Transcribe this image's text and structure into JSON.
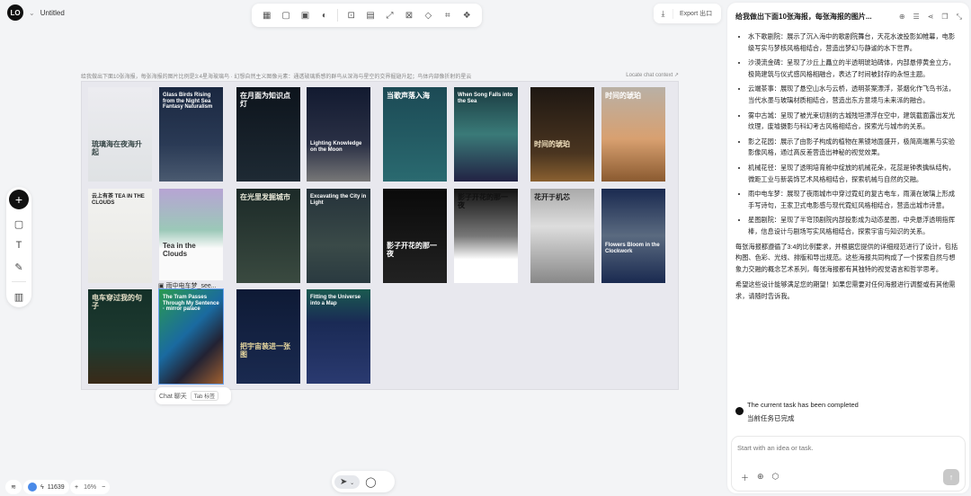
{
  "app": {
    "logo": "LO",
    "title": "Untitled"
  },
  "toolbar": {
    "tools": [
      {
        "icon": "mosaic-icon",
        "glyph": "▦"
      },
      {
        "icon": "square-icon",
        "glyph": "▢"
      },
      {
        "icon": "frame-text-icon",
        "glyph": "▣"
      },
      {
        "icon": "erase-bg-icon",
        "glyph": "◐"
      },
      {
        "icon": "ai-edit-icon",
        "glyph": "⊡"
      },
      {
        "icon": "hd-icon",
        "glyph": "▤"
      },
      {
        "icon": "expand-icon",
        "glyph": "⤢"
      },
      {
        "icon": "image-icon",
        "glyph": "⊠"
      },
      {
        "icon": "eraser-icon",
        "glyph": "◇"
      },
      {
        "icon": "crop-icon",
        "glyph": "⌗"
      },
      {
        "icon": "layers-3d-icon",
        "glyph": "❖"
      }
    ]
  },
  "export": {
    "label": "Export 出口"
  },
  "canvas": {
    "context_prompt": "给我做出下面10张海报，每张海报的图片比例是3:4星海玻璃鸟 · 幻想自然主义图像元素：通透玻璃质感的群鸟从深海与星空的交界掘翅升起；鸟体内部像折射的星云",
    "locate_label": "Locate chat context ↗",
    "selected_caption": "雨中电车梦_see...",
    "posters": [
      {
        "title": "琉璃海在夜海升起",
        "bg": "linear-gradient(#ececf0,#dfe2e4)",
        "color": "#3a4a4a"
      },
      {
        "title": "Glass Birds Rising from the Night Sea Fantasy Naturalism",
        "bg": "linear-gradient(#1a2740,#2a3a55 60%,#4a5a70)",
        "color": "#fff"
      },
      {
        "title": "在月面为知识点灯",
        "bg": "linear-gradient(#0d141c,#1e2a34)",
        "color": "#fff"
      },
      {
        "title": "Lighting Knowledge on the Moon",
        "bg": "linear-gradient(#121a30,#2a3045 60%,#777)",
        "color": "#fff"
      },
      {
        "title": "当歌声落入海",
        "bg": "linear-gradient(#1c4a55,#2a6a70)",
        "color": "#fff"
      },
      {
        "title": "When Song Falls into the Sea",
        "bg": "linear-gradient(#1a3a40,#3a7a78 50%,#224)",
        "color": "#fff"
      },
      {
        "title": "时间的琥珀",
        "bg": "linear-gradient(#1e1712,#4a3520 70%,#8a6030)",
        "color": "#f3e3c0"
      },
      {
        "title": "时间的琥珀",
        "bg": "linear-gradient(#b9b0a5,#d8a070 55%,#8a5a30)",
        "color": "#fff"
      },
      {
        "title": "云上有茶 TEA IN THE CLOUDS",
        "bg": "linear-gradient(#f2f2f0,#e8e8e4)",
        "color": "#222"
      },
      {
        "title": "Tea in the Clouds",
        "bg": "linear-gradient(#b7a4d4,#9bc8b8 45%,#fafafa 65%)",
        "color": "#333"
      },
      {
        "title": "在光里发掘城市",
        "bg": "linear-gradient(#1c2a28,#3a4a40)",
        "color": "#e8e8d8"
      },
      {
        "title": "Excavating the City in Light",
        "bg": "linear-gradient(#25323a,#3a4a48 60%,#2a3a40)",
        "color": "#fff"
      },
      {
        "title": "影子开花的那一夜",
        "bg": "linear-gradient(#0a0a0a,#222)",
        "color": "#fff"
      },
      {
        "title": "影子开花的那一夜",
        "bg": "linear-gradient(#111,#777 50%,#fff 75%)",
        "color": "#111"
      },
      {
        "title": "花开于机芯",
        "bg": "linear-gradient(#aaa,#ddd 40%,#888)",
        "color": "#222"
      },
      {
        "title": "Flowers Bloom in the Clockwork",
        "bg": "linear-gradient(#1a2a50,#5a6a80 50%,#1a2a50)",
        "color": "#fff"
      },
      {
        "title": "电车穿过我的句子",
        "bg": "linear-gradient(#143028,#1e3a30 60%,#3a2a18)",
        "color": "#e6e0c8"
      },
      {
        "title": "The Tram Passes Through My Sentence · mirror palace",
        "bg": "linear-gradient(135deg,#2a9a50,#1a6aa0 45%,#223 70%,#a06030)",
        "color": "#fff"
      },
      {
        "title": "把宇宙装进一张图",
        "bg": "linear-gradient(#0e1a35,#1a2a50)",
        "color": "#e8d8a0"
      },
      {
        "title": "Fitting the Universe into a Map",
        "bg": "linear-gradient(#1a5a50,#1a2a55 35%,#2a3a70)",
        "color": "#fff"
      }
    ]
  },
  "chat_pill": {
    "chat": "Chat 聊天",
    "tab": "Tab 标签"
  },
  "left_tools": [
    {
      "icon": "plus-icon",
      "glyph": "+"
    },
    {
      "icon": "rectangle-icon",
      "glyph": "▢"
    },
    {
      "icon": "text-icon",
      "glyph": "T"
    },
    {
      "icon": "pencil-icon",
      "glyph": "✎"
    },
    {
      "icon": "template-icon",
      "glyph": "▥"
    }
  ],
  "bottom": {
    "credits": "11639",
    "zoom": "16%"
  },
  "panel": {
    "title": "给我做出下面10张海报，每张海报的图片...",
    "items": [
      "水下歌剧院：展示了沉入海中的歌剧院舞台，天花水波投影如帷幕，电影级写实与梦核风格相结合，营造出梦幻与静谧的水下世界。",
      "沙漠流金碑：呈现了沙丘上矗立的半透明琥珀碑体，内部悬停黄金立方，极简建筑与仪式感风格相融合，表达了时间被封存的永恒主题。",
      "云端茶事：展现了悬空山水与云桥，透明茶案漂浮，茶烟化作飞鸟书法，当代水墨与玻璃材质相结合，营造出东方意境与未来派的融合。",
      "雾中古城：呈现了被光束切割的古城残垣漂浮在空中，建筑截面露出发光纹理，废墟摄影与科幻考古风格相结合，探索光与城市的关系。",
      "影之花园：展示了由影子构成的植物在黑镜地面盛开，极简高端黑与实验影像风格，通过高反差营造出神秘的视觉效果。",
      "机械花径：呈现了透明培育舱中绽放的机械花朵，花蕊是钟表擒纵结构，微距工业与新装饰艺术风格相结合，探索机械与自然的交融。",
      "雨中电车梦：展现了夜雨城市中穿过霓虹的复古电车，雨滴在玻璃上形成手写诗句，王家卫式电影感与现代霓虹风格相结合，营造出城市诗意。",
      "星图剧院：呈现了半穹顶剧院内部投影成为动态星图，中央悬浮透明指挥棒，信息设计与剧场写实风格相结合，探索宇宙与知识的关系。"
    ],
    "summary": "每张海报都遵循了3:4的比例要求，并根据您提供的详细规范进行了设计，包括构图、色彩、光线、排版和导出规范。这些海报共同构成了一个探索自然与想象力交融的概念艺术系列，每张海报都有其独特的视觉语言和哲学思考。",
    "closing": "希望这些设计能够满足您的期望！如果您需要对任何海报进行调整或有其他需求，请随时告诉我。",
    "status_en": "The current task has been completed",
    "status_zh": "当前任务已完成",
    "input_placeholder": "Start with an idea or task."
  }
}
